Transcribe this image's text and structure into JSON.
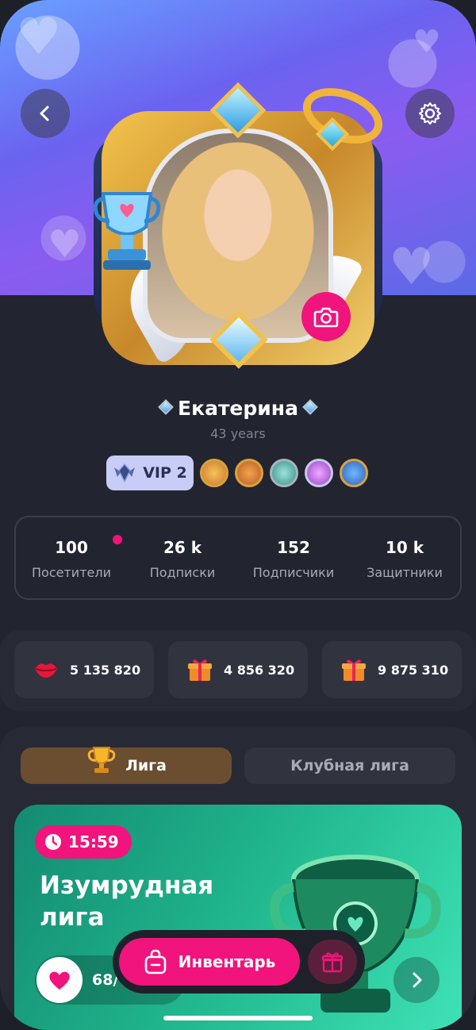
{
  "profile": {
    "name": "Екатерина",
    "age": "43 years",
    "vip_label": "VIP 2"
  },
  "stats": [
    {
      "value": "100",
      "label": "Посетители"
    },
    {
      "value": "26 k",
      "label": "Подписки"
    },
    {
      "value": "152",
      "label": "Подписчики"
    },
    {
      "value": "10 k",
      "label": "Защитники"
    }
  ],
  "currencies": [
    {
      "icon": "kiss-lips-icon",
      "value": "5 135 820"
    },
    {
      "icon": "gift-box-icon",
      "value": "4 856 320"
    },
    {
      "icon": "gift-box-icon",
      "value": "9 875 310"
    }
  ],
  "tabs": {
    "league": "Лига",
    "club_league": "Клубная лига"
  },
  "league_card": {
    "timer": "15:59",
    "title": "Изумрудная лига",
    "progress_text": "68/"
  },
  "bottom": {
    "inventory_label": "Инвентарь"
  },
  "colors": {
    "accent": "#f0147c",
    "background": "#22252f",
    "card": "#31343f",
    "league_green": "#1fb38a",
    "vip_badge": "#c7cdf7"
  }
}
